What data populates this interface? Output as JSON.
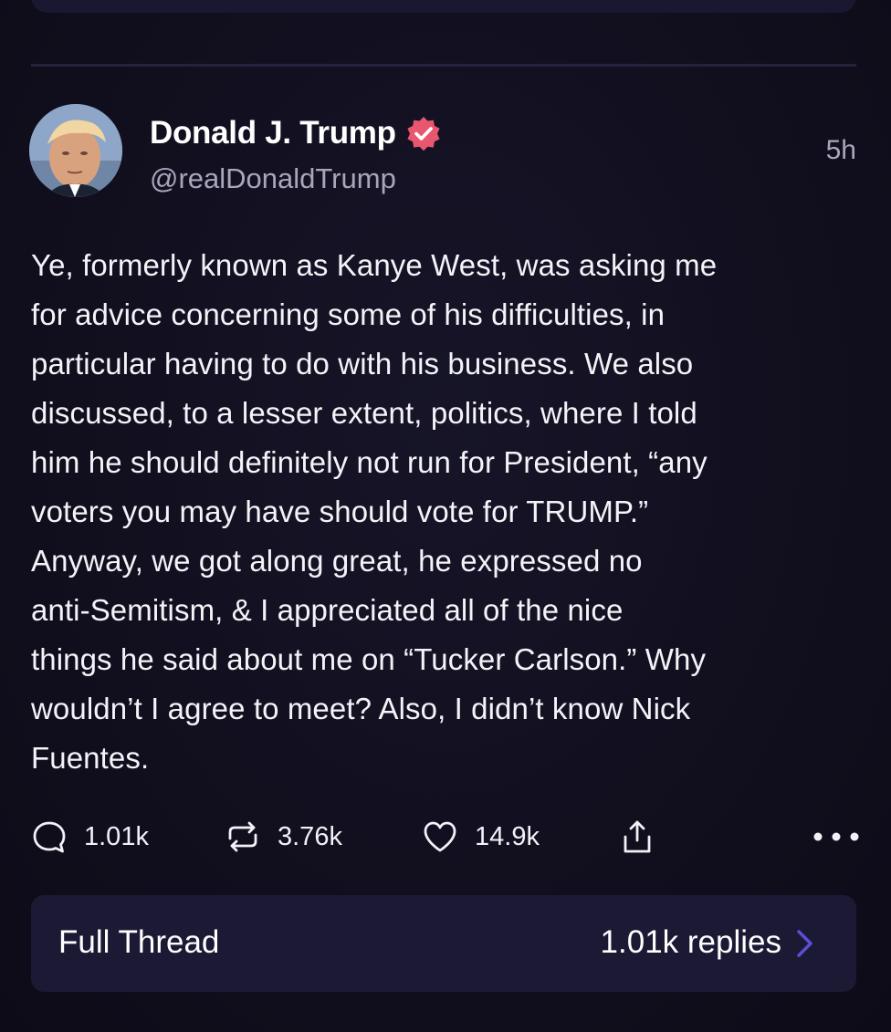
{
  "post": {
    "author_name": "Donald J. Trump",
    "handle": "@realDonaldTrump",
    "timestamp": "5h",
    "body": "Ye, formerly known as Kanye West, was asking me\nfor advice concerning some of his difficulties, in\nparticular having to do with his business. We also\ndiscussed, to a lesser extent, politics, where I told\nhim he should definitely not run for President, “any\nvoters you may have should vote for TRUMP.”\nAnyway, we got along great, he expressed no\nanti-Semitism, & I appreciated all of the nice\nthings he said about me on “Tucker Carlson.” Why\nwouldn’t I agree to meet? Also, I didn’t know Nick\nFuentes.",
    "verified_badge_color": "#e8566f"
  },
  "actions": {
    "reply": {
      "icon": "speech-bubble-icon",
      "count": "1.01k"
    },
    "repost": {
      "icon": "repost-arrows-icon",
      "count": "3.76k"
    },
    "like": {
      "icon": "heart-icon",
      "count": "14.9k"
    },
    "share": {
      "icon": "share-upload-icon"
    },
    "more": {
      "icon": "more-dots-icon"
    }
  },
  "thread": {
    "label": "Full Thread",
    "replies": "1.01k replies",
    "chevron_color": "#5a4fd6"
  },
  "colors": {
    "background": "#12101f",
    "card": "#1c1934",
    "secondary_text": "#a9a6bb"
  }
}
